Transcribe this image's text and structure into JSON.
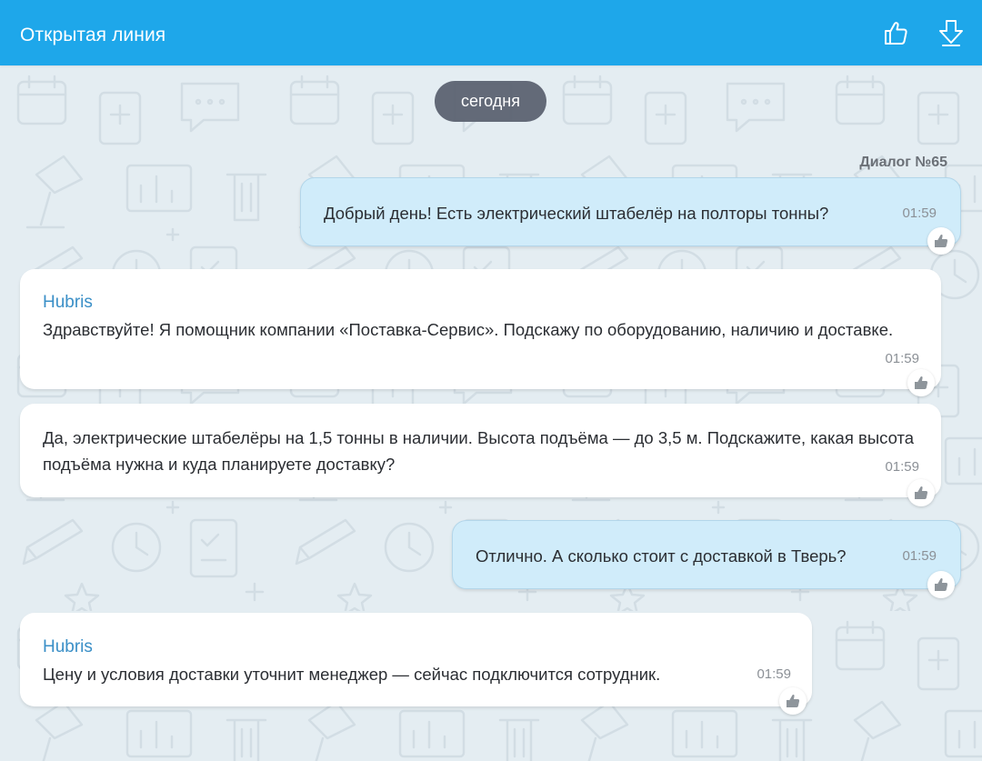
{
  "header": {
    "title": "Открытая линия",
    "like_icon": "thumbs-up-icon",
    "download_icon": "download-arrow-icon"
  },
  "chat": {
    "date_label": "сегодня",
    "dialog_label": "Диалог №65",
    "messages": [
      {
        "direction": "out",
        "text": "Добрый день! Есть электрический штабелёр на полторы тонны?",
        "time": "01:59"
      },
      {
        "direction": "in",
        "sender": "Hubris",
        "text": "Здравствуйте! Я помощник компании «Поставка-Сервис». Подскажу по оборудованию, наличию и доставке.",
        "time": "01:59"
      },
      {
        "direction": "in",
        "text": "Да, электрические штабелёры на 1,5 тонны в наличии. Высота подъёма — до 3,5 м. Подскажите, какая высота подъёма нужна и куда планируете доставку?",
        "time": "01:59"
      },
      {
        "direction": "out",
        "text": "Отлично. А сколько стоит с доставкой в Тверь?",
        "time": "01:59"
      },
      {
        "direction": "in",
        "sender": "Hubris",
        "text": "Цену и условия доставки уточнит менеджер — сейчас подключится сотрудник.",
        "time": "01:59"
      }
    ]
  },
  "colors": {
    "header": "#1ea7ea",
    "outgoing_bubble": "#d0ecfa",
    "incoming_bubble": "#ffffff",
    "sender_name": "#3a8fc7",
    "chat_background": "#e4edf2"
  }
}
